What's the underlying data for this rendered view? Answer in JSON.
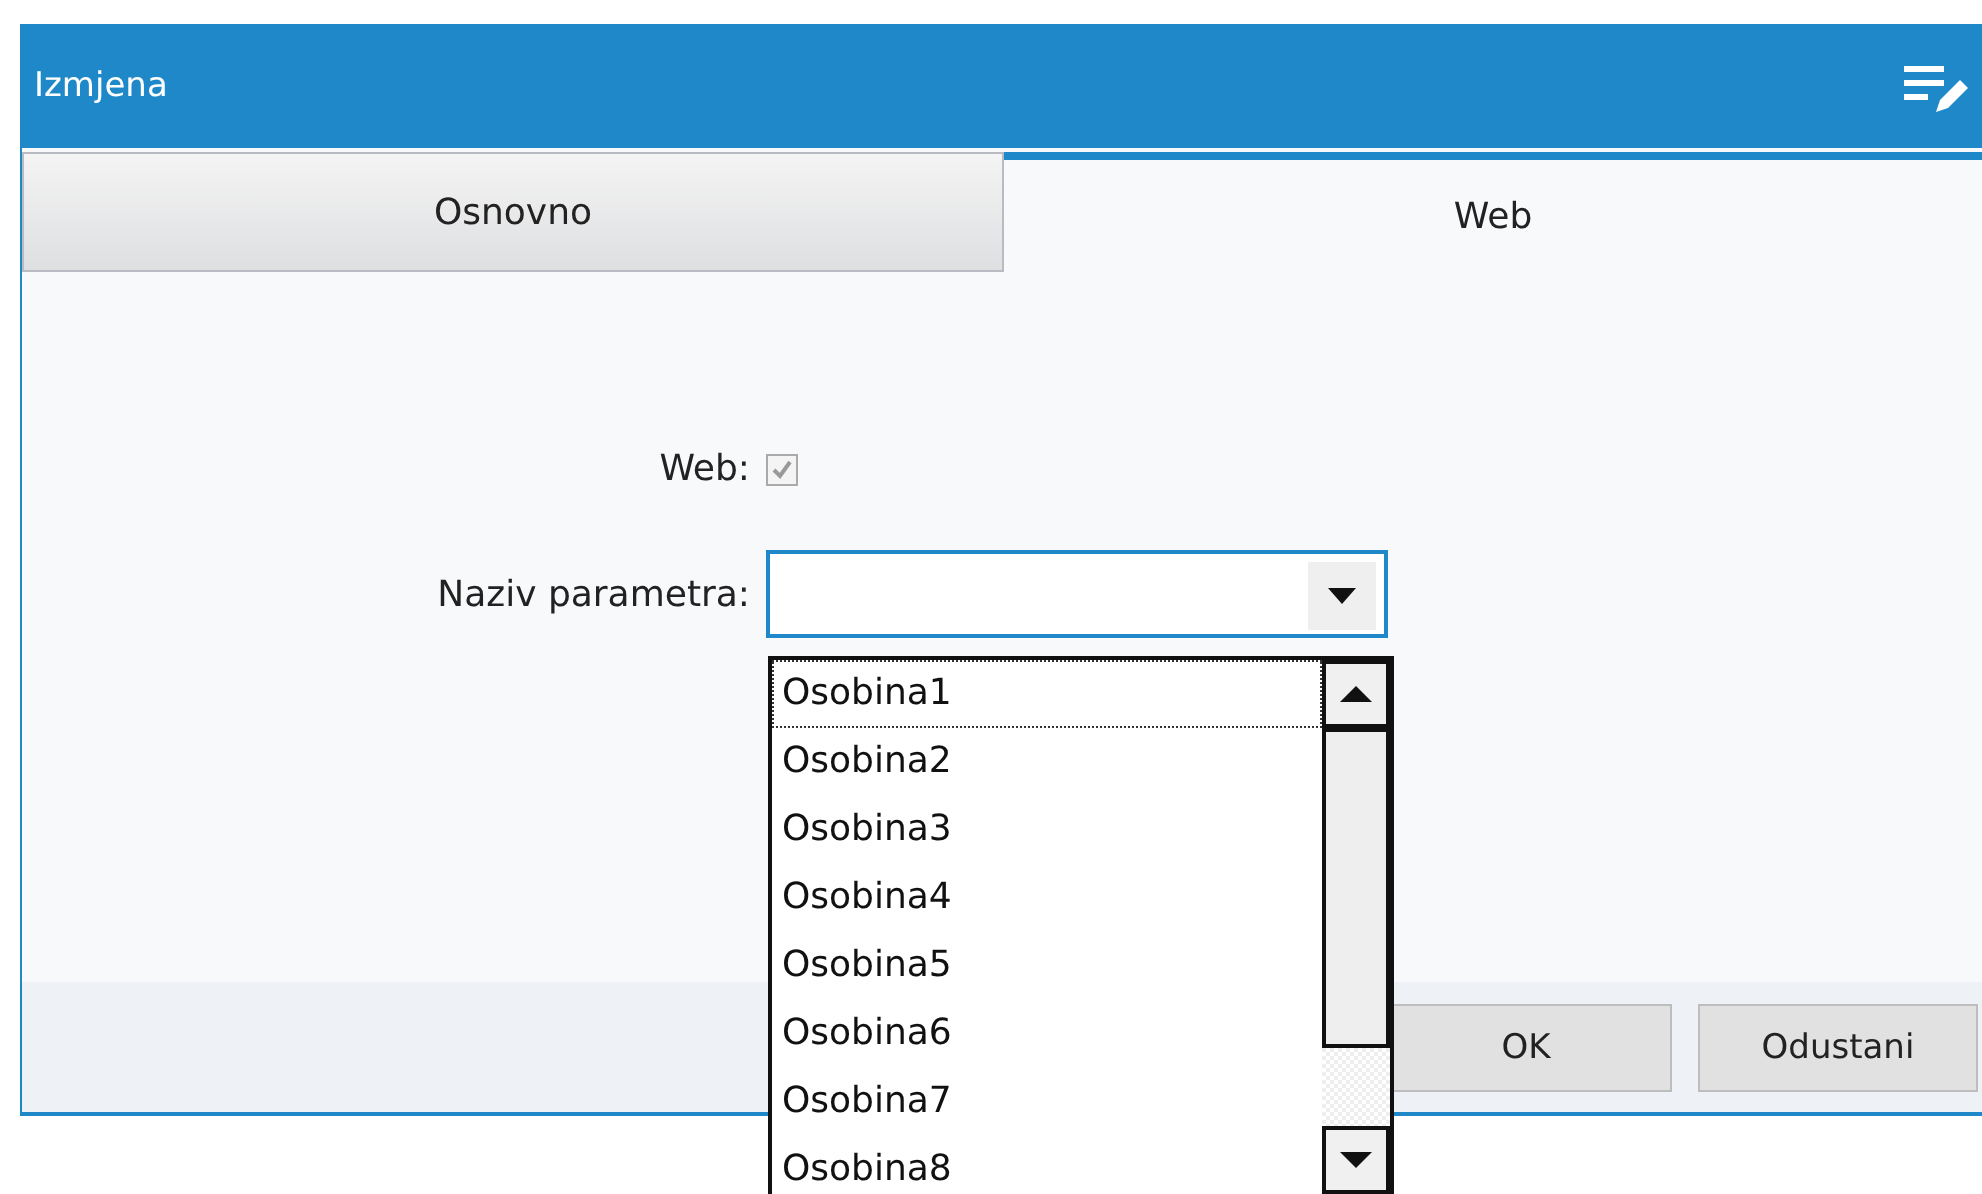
{
  "window": {
    "title": "Izmjena"
  },
  "tabs": [
    {
      "label": "Osnovno",
      "selected": false
    },
    {
      "label": "Web",
      "selected": true
    }
  ],
  "form": {
    "web": {
      "label": "Web:",
      "checked": true,
      "disabled": true
    },
    "parameter": {
      "label": "Naziv parametra:",
      "expanded": true
    }
  },
  "dropdown": {
    "items": [
      {
        "label": "Osobina1",
        "selected": true
      },
      {
        "label": "Osobina2",
        "selected": false
      },
      {
        "label": "Osobina3",
        "selected": false
      },
      {
        "label": "Osobina4",
        "selected": false
      },
      {
        "label": "Osobina5",
        "selected": false
      },
      {
        "label": "Osobina6",
        "selected": false
      },
      {
        "label": "Osobina7",
        "selected": false
      },
      {
        "label": "Osobina8",
        "selected": false
      }
    ]
  },
  "buttons": [
    "OK",
    "Odustani"
  ]
}
